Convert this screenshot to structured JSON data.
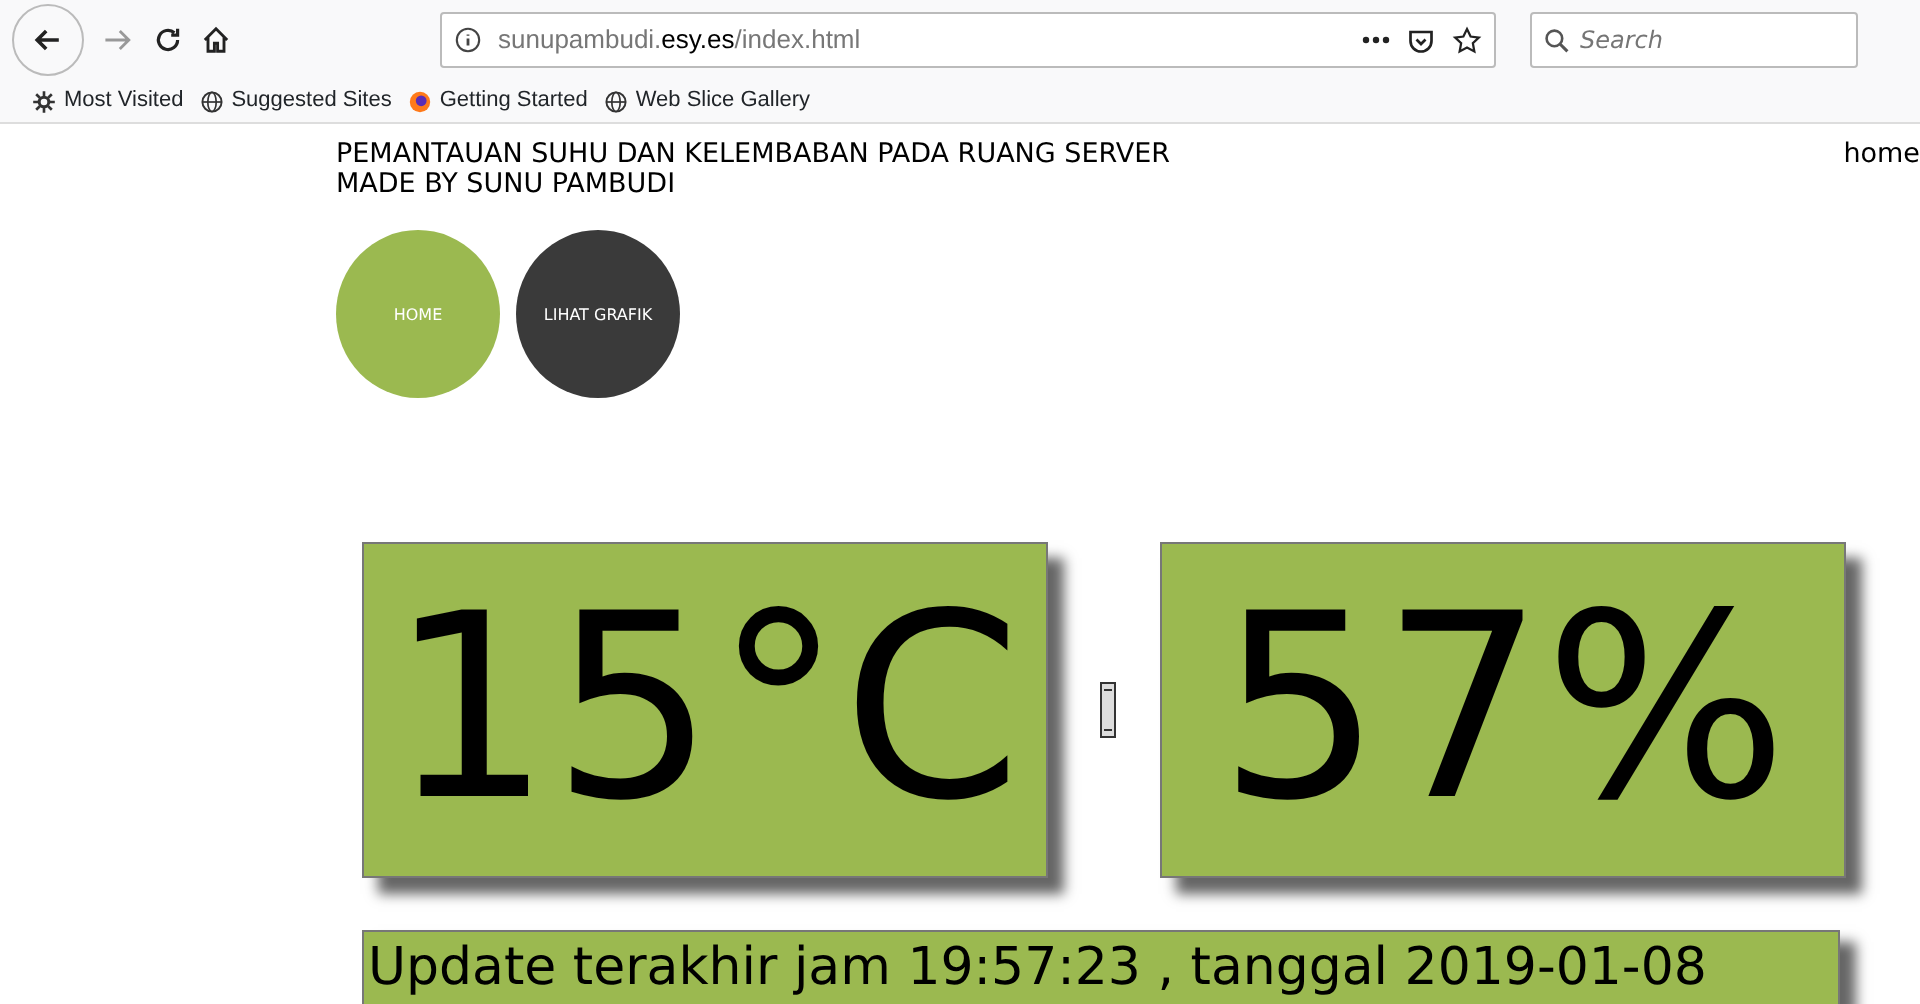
{
  "browser": {
    "url_host": "sunupambudi.",
    "url_domain": "esy.es",
    "url_path": "/index.html",
    "search": {
      "placeholder": "Search"
    },
    "bookmarks": [
      {
        "label": "Most Visited",
        "kind": "gear"
      },
      {
        "label": "Suggested Sites",
        "kind": "globe"
      },
      {
        "label": "Getting Started",
        "kind": "fox"
      },
      {
        "label": "Web Slice Gallery",
        "kind": "globe"
      }
    ]
  },
  "header": {
    "title": "PEMANTAUAN SUHU DAN KELEMBABAN PADA RUANG SERVER",
    "subtitle": "MADE BY SUNU PAMBUDI",
    "link": "home"
  },
  "nav": [
    {
      "label": "HOME",
      "selected": true
    },
    {
      "label": "LIHAT GRAFIK",
      "selected": false
    }
  ],
  "readings": [
    {
      "value": "15°C"
    },
    {
      "value": "57%"
    }
  ],
  "update": "Update terakhir jam 19:57:23 , tanggal 2019-01-08"
}
